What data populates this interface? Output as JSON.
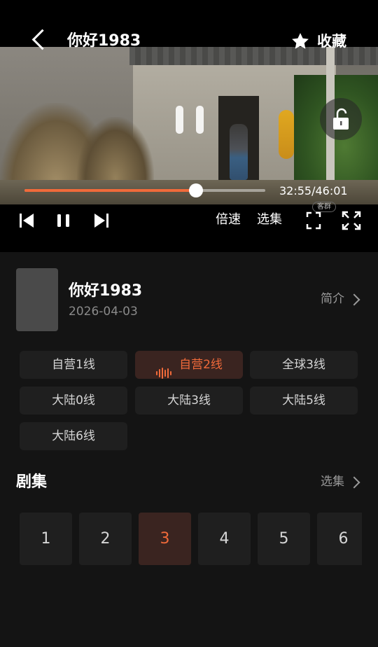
{
  "player": {
    "title": "你好1983",
    "favorite_label": "收藏",
    "progress": 0.713,
    "time_display": "32:55/46:01",
    "speed_label": "倍速",
    "episodes_label": "选集",
    "watermark": "客群"
  },
  "info": {
    "title": "你好1983",
    "date": "2026-04-03",
    "intro_label": "简介"
  },
  "lines": [
    {
      "label": "自营1线",
      "active": false
    },
    {
      "label": "自营2线",
      "active": true
    },
    {
      "label": "全球3线",
      "active": false
    },
    {
      "label": "大陆0线",
      "active": false
    },
    {
      "label": "大陆3线",
      "active": false
    },
    {
      "label": "大陆5线",
      "active": false
    },
    {
      "label": "大陆6线",
      "active": false
    }
  ],
  "episodes_section": {
    "heading": "剧集",
    "select_label": "选集",
    "items": [
      "1",
      "2",
      "3",
      "4",
      "5",
      "6"
    ],
    "active_index": 2
  },
  "colors": {
    "accent": "#f06a3a",
    "active_bg": "#3a2420",
    "button_bg": "#1f1f1f",
    "page_bg": "#141414"
  },
  "icons": [
    "back-icon",
    "star-icon",
    "pause-icon",
    "unlock-icon",
    "skip-previous-icon",
    "skip-next-icon",
    "fullscreen-icon",
    "expand-icon",
    "chevron-right-icon",
    "sound-wave-icon"
  ]
}
